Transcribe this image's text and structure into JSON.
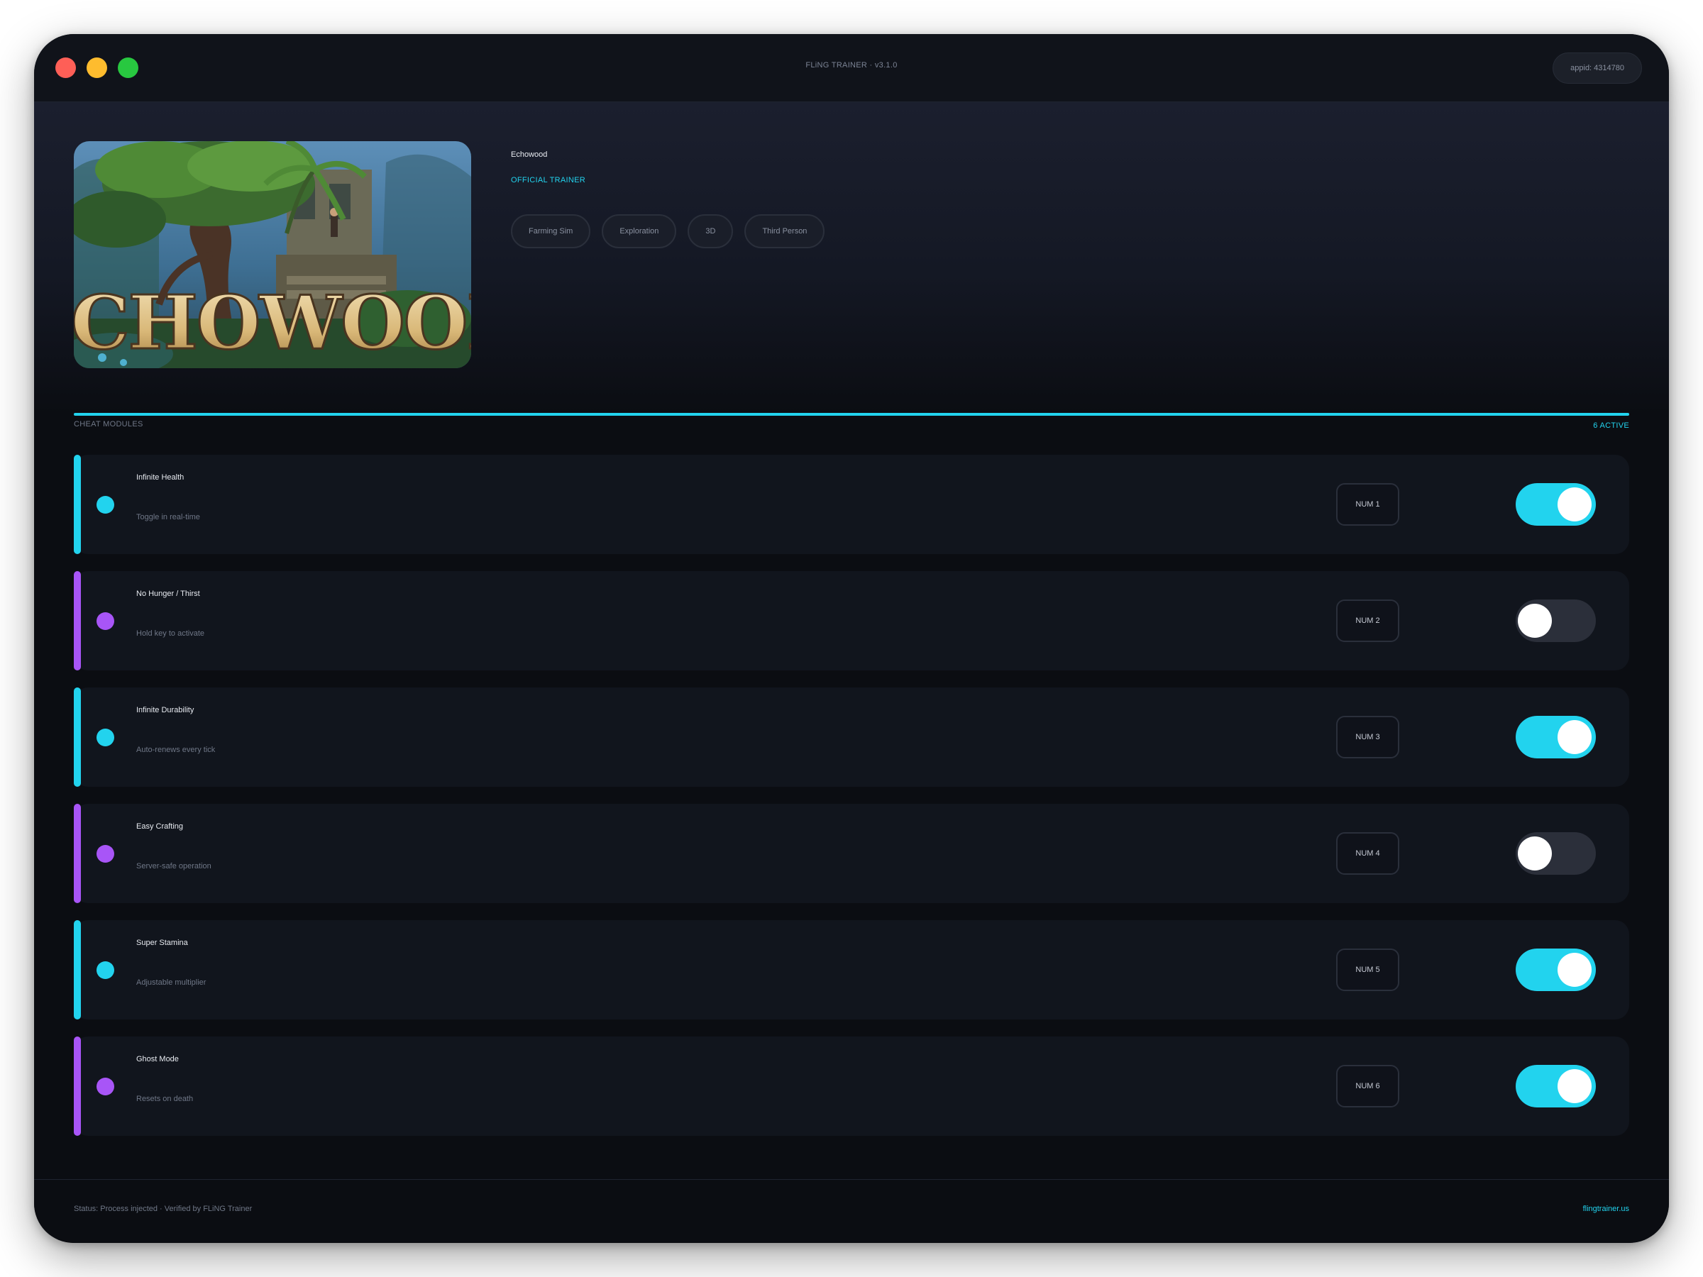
{
  "window": {
    "title": "FLiNG TRAINER · v3.1.0",
    "appid_label": "appid: 4314780"
  },
  "game": {
    "name": "Echowood",
    "badge": "OFFICIAL TRAINER",
    "cover_logo_text": "ECHOWOOD",
    "tags": [
      "Farming Sim",
      "Exploration",
      "3D",
      "Third Person"
    ]
  },
  "section": {
    "label": "CHEAT MODULES",
    "active_count": "6 ACTIVE"
  },
  "modules": [
    {
      "name": "Infinite Health",
      "desc": "Toggle in real-time",
      "hotkey": "NUM 1",
      "enabled": true,
      "accent": "#22d3ee"
    },
    {
      "name": "No Hunger / Thirst",
      "desc": "Hold key to activate",
      "hotkey": "NUM 2",
      "enabled": false,
      "accent": "#a855f7"
    },
    {
      "name": "Infinite Durability",
      "desc": "Auto-renews every tick",
      "hotkey": "NUM 3",
      "enabled": true,
      "accent": "#22d3ee"
    },
    {
      "name": "Easy Crafting",
      "desc": "Server-safe operation",
      "hotkey": "NUM 4",
      "enabled": false,
      "accent": "#a855f7"
    },
    {
      "name": "Super Stamina",
      "desc": "Adjustable multiplier",
      "hotkey": "NUM 5",
      "enabled": true,
      "accent": "#22d3ee"
    },
    {
      "name": "Ghost Mode",
      "desc": "Resets on death",
      "hotkey": "NUM 6",
      "enabled": true,
      "accent": "#a855f7"
    }
  ],
  "footer": {
    "status": "Status: Process injected · Verified by FLiNG Trainer",
    "site": "flingtrainer.us"
  },
  "colors": {
    "accent_cyan": "#22d3ee",
    "accent_purple": "#a855f7",
    "toggle_off": "#2b2f3a",
    "background": "#0b0d12"
  }
}
